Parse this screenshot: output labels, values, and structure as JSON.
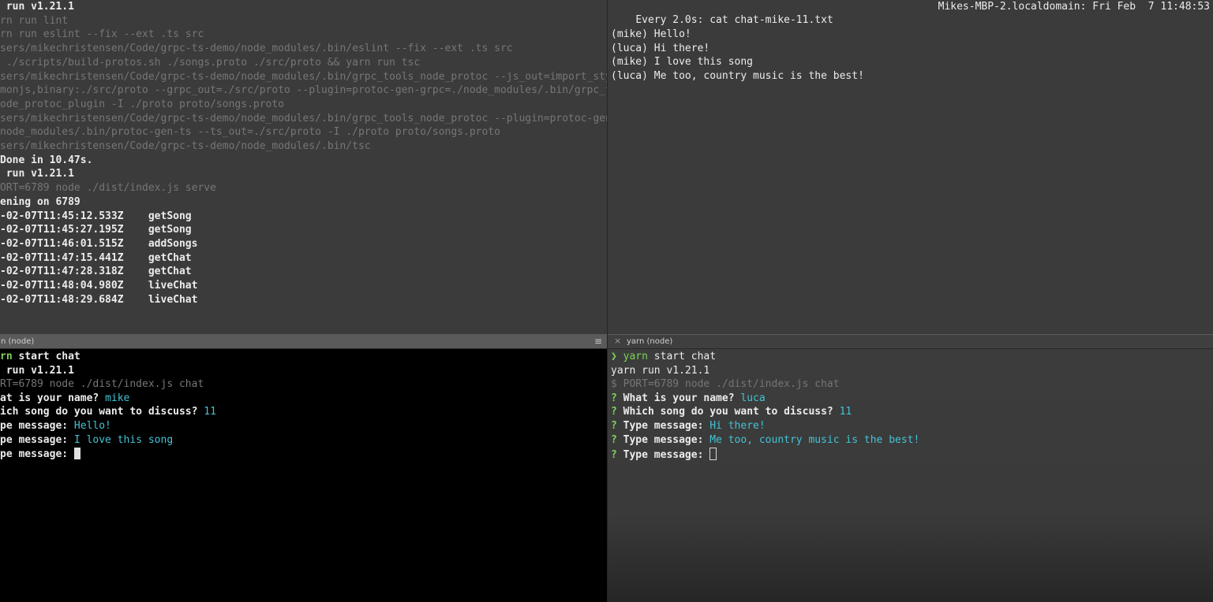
{
  "top_left": {
    "lines": [
      {
        "text": " run v1.21.1",
        "style": "white"
      },
      {
        "text": "rn run lint",
        "style": "dim"
      },
      {
        "text": "rn run eslint --fix --ext .ts src",
        "style": "dim"
      },
      {
        "text": "sers/mikechristensen/Code/grpc-ts-demo/node_modules/.bin/eslint --fix --ext .ts src",
        "style": "dim"
      },
      {
        "text": " ./scripts/build-protos.sh ./songs.proto ./src/proto && yarn run tsc",
        "style": "dim"
      },
      {
        "text": "sers/mikechristensen/Code/grpc-ts-demo/node_modules/.bin/grpc_tools_node_protoc --js_out=import_style",
        "style": "dim"
      },
      {
        "text": "monjs,binary:./src/proto --grpc_out=./src/proto --plugin=protoc-gen-grpc=./node_modules/.bin/grpc_too",
        "style": "dim"
      },
      {
        "text": "ode_protoc_plugin -I ./proto proto/songs.proto",
        "style": "dim"
      },
      {
        "text": "sers/mikechristensen/Code/grpc-ts-demo/node_modules/.bin/grpc_tools_node_protoc --plugin=protoc-gen-t",
        "style": "dim"
      },
      {
        "text": "node_modules/.bin/protoc-gen-ts --ts_out=./src/proto -I ./proto proto/songs.proto",
        "style": "dim"
      },
      {
        "text": "sers/mikechristensen/Code/grpc-ts-demo/node_modules/.bin/tsc",
        "style": "dim"
      },
      {
        "text": "Done in 10.47s.",
        "style": "white"
      },
      {
        "text": " run v1.21.1",
        "style": "white"
      },
      {
        "text": "ORT=6789 node ./dist/index.js serve",
        "style": "dim"
      },
      {
        "text": "ening on 6789",
        "style": "white"
      },
      {
        "text": "-02-07T11:45:12.533Z    getSong",
        "style": "white"
      },
      {
        "text": "-02-07T11:45:27.195Z    getSong",
        "style": "white"
      },
      {
        "text": "-02-07T11:46:01.515Z    addSongs",
        "style": "white"
      },
      {
        "text": "-02-07T11:47:15.441Z    getChat",
        "style": "white"
      },
      {
        "text": "-02-07T11:47:28.318Z    getChat",
        "style": "white"
      },
      {
        "text": "-02-07T11:48:04.980Z    liveChat",
        "style": "white"
      },
      {
        "text": "-02-07T11:48:29.684Z    liveChat",
        "style": "white"
      }
    ]
  },
  "top_right": {
    "header_left": "Every 2.0s: cat chat-mike-11.txt",
    "header_right": "Mikes-MBP-2.localdomain: Fri Feb  7 11:48:53",
    "lines": [
      "(mike) Hello!",
      "(luca) Hi there!",
      "(mike) I love this song",
      "(luca) Me too, country music is the best!"
    ]
  },
  "tabs": {
    "left_title": "n (node)",
    "right_title": "yarn (node)",
    "hamburger": "≡",
    "close": "×"
  },
  "bottom_left": {
    "cmd_prefix": "rn",
    "cmd_rest": " start chat",
    "yarn_version": " run v1.21.1",
    "node_cmd": "RT=6789 node ./dist/index.js chat",
    "q1_label": "at is your name? ",
    "q1_answer": "mike",
    "q2_label": "ich song do you want to discuss? ",
    "q2_answer": "11",
    "msg_label": "pe message: ",
    "msg1": "Hello!",
    "msg2": "I love this song"
  },
  "bottom_right": {
    "prompt": "❯ ",
    "cmd_yarn": "yarn",
    "cmd_rest": " start chat",
    "yarn_version": "yarn run v1.21.1",
    "node_cmd": "$ PORT=6789 node ./dist/index.js chat",
    "qmark": "? ",
    "q1_label": "What is your name? ",
    "q1_answer": "luca",
    "q2_label": "Which song do you want to discuss? ",
    "q2_answer": "11",
    "msg_label": "Type message: ",
    "msg1": "Hi there!",
    "msg2": "Me too, country music is the best!"
  },
  "colors": {
    "pane_bg": "#3b3b3b",
    "terminal_black": "#000000",
    "text_white": "#ececec",
    "text_dim": "#767676",
    "answer_cyan": "#43c3d5",
    "prompt_green": "#7ed35a"
  }
}
